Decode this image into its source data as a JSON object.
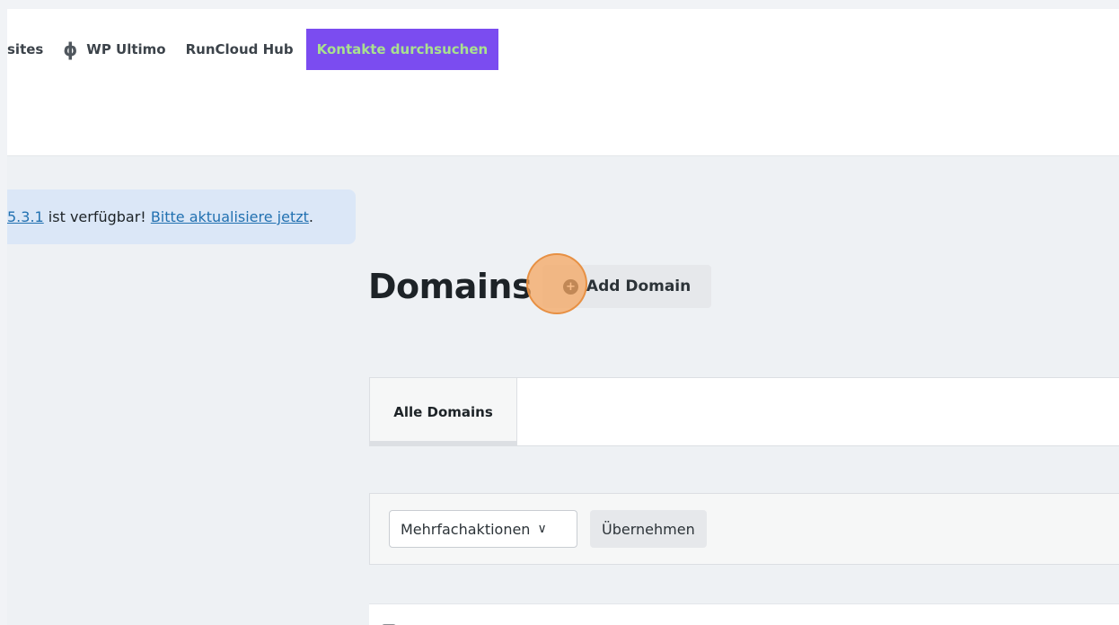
{
  "nav": {
    "items": [
      {
        "label": "sites",
        "icon": ""
      },
      {
        "label": "WP Ultimo",
        "icon": "wp-ultimo-icon"
      },
      {
        "label": "RunCloud Hub",
        "icon": ""
      }
    ],
    "highlight": "Kontakte durchsuchen",
    "highlight_bg": "#7b4cf0",
    "highlight_fg": "#a9e08f"
  },
  "notice": {
    "version_link": "5.3.1",
    "middle": " ist verfügbar! ",
    "update_link": "Bitte aktualisiere jetzt",
    "end": "."
  },
  "page": {
    "title": "Domains",
    "add_button": "Add Domain"
  },
  "tabs": [
    {
      "label": "Alle Domains",
      "active": true
    }
  ],
  "bulk": {
    "select_value": "Mehrfachaktionen",
    "apply_label": "Übernehmen"
  }
}
